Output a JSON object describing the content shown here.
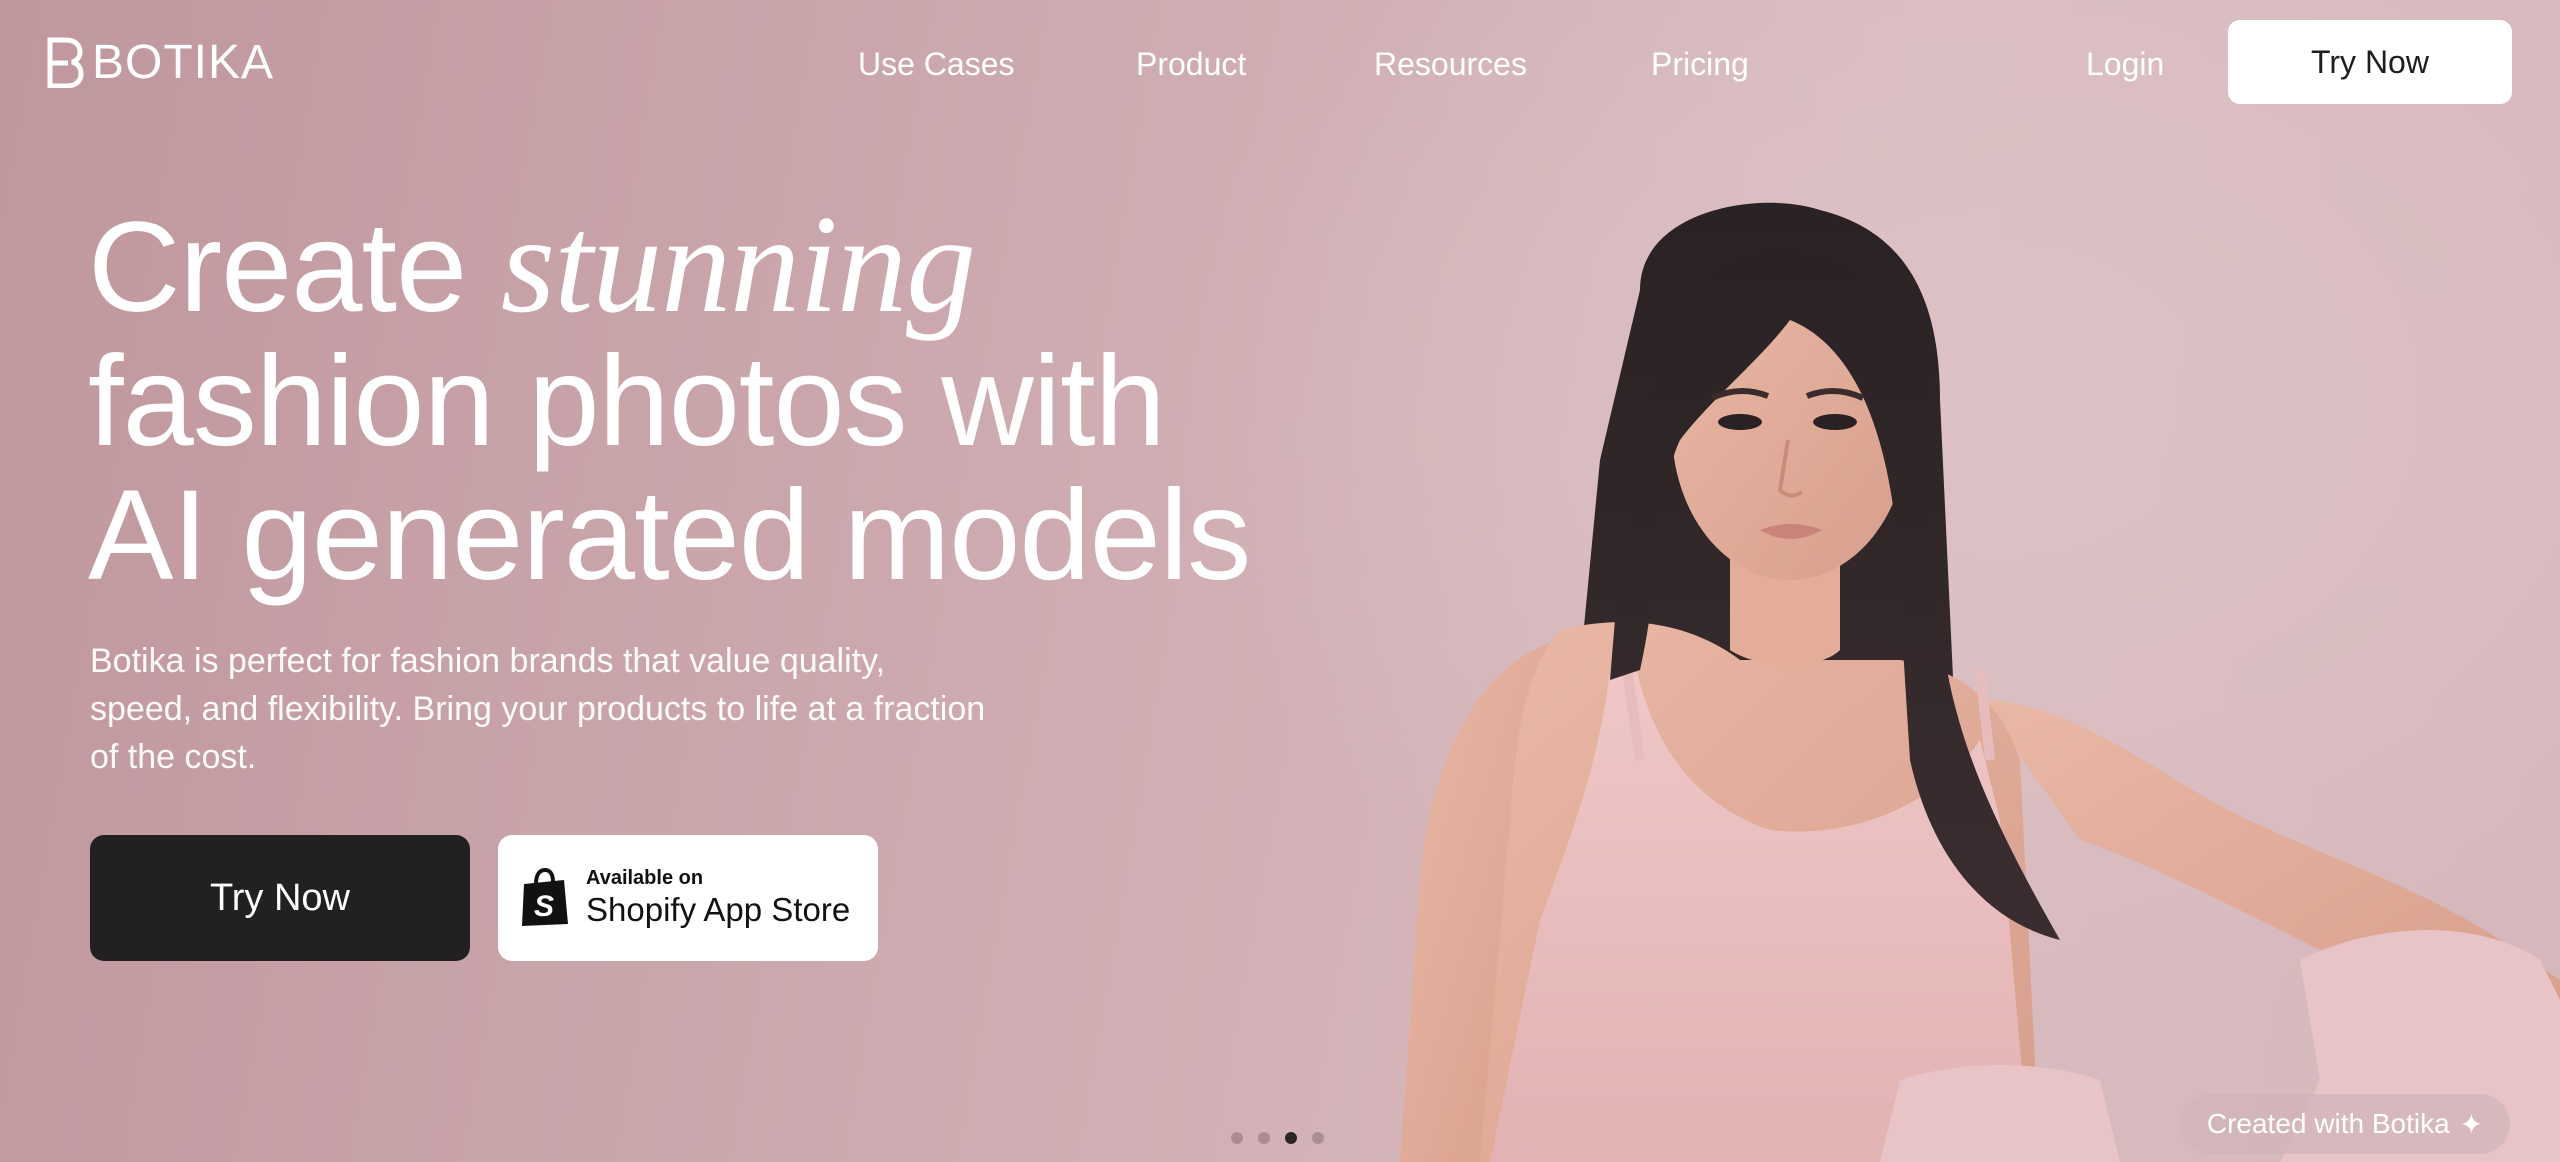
{
  "brand": {
    "name": "BOTIKA",
    "logo_icon": "botika-b-icon"
  },
  "nav": {
    "links": [
      "Use Cases",
      "Product",
      "Resources",
      "Pricing"
    ],
    "login": "Login",
    "cta": "Try Now"
  },
  "hero": {
    "headline_1_plain": "Create ",
    "headline_1_italic": "stunning",
    "headline_2": "fashion photos with",
    "headline_3": "AI generated models",
    "subtext": "Botika is perfect for fashion brands that value quality, speed, and flexibility. Bring your products to life at a fraction of the cost.",
    "primary_cta": "Try Now",
    "shopify_small": "Available on",
    "shopify_big": "Shopify App Store",
    "shopify_icon": "shopify-bag-icon"
  },
  "carousel": {
    "active_index": 3,
    "count": 4
  },
  "badge": {
    "label": "Created with Botika",
    "icon": "sparkle-icon"
  },
  "colors": {
    "background": "#c9a3a9",
    "primary_button": "#222020",
    "white": "#ffffff"
  }
}
